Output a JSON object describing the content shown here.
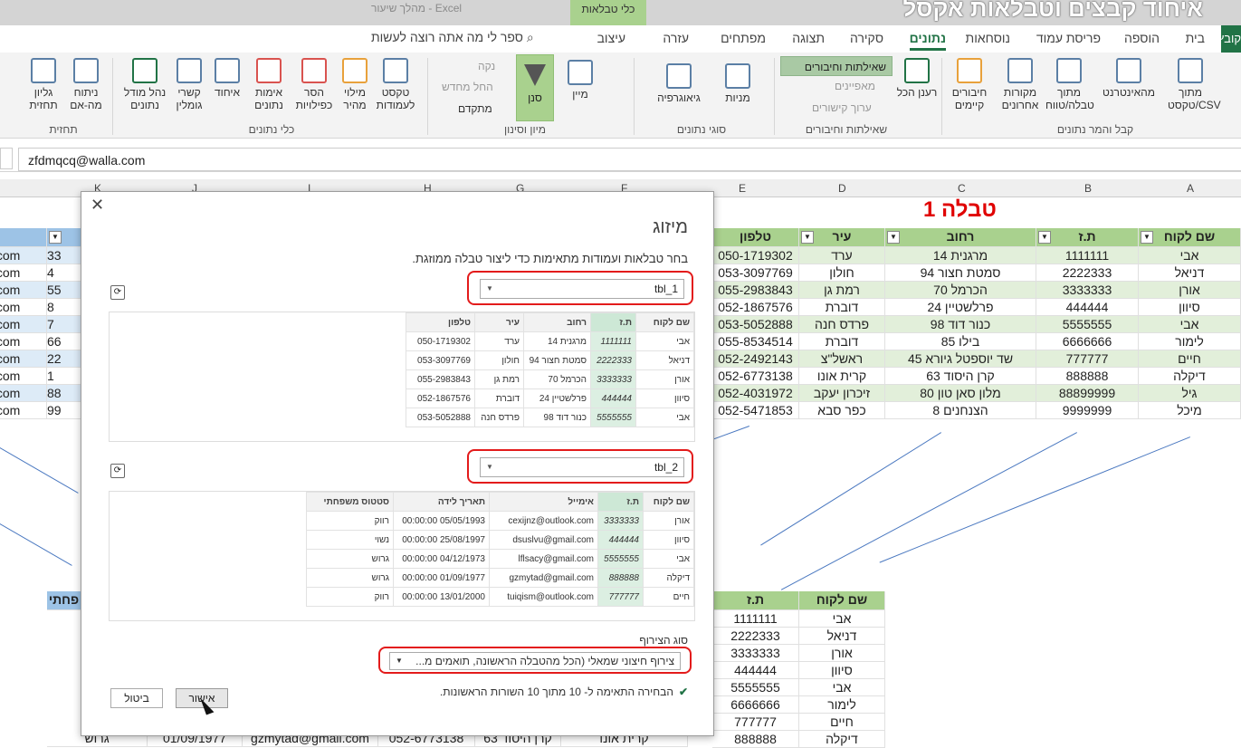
{
  "titlebar": {
    "doc": "מהלך שיעור  -  Excel",
    "context_tab": "כלי טבלאות",
    "overlay_title": "איחוד קבצים וטבלאות אקסל"
  },
  "tabs": {
    "file": "קובץ",
    "home": "בית",
    "insert": "הוספה",
    "layout": "פריסת עמוד",
    "formulas": "נוסחאות",
    "data": "נתונים",
    "review": "סקירה",
    "view": "תצוגה",
    "developer": "מפתחים",
    "help": "עזרה",
    "design": "עיצוב",
    "tellme": "ספר לי מה אתה רוצה לעשות"
  },
  "ribbon": {
    "from_text": "מתוך טקסט/CSV",
    "from_web": "מהאינטרנט",
    "from_table": "מתוך טבלה/טווח",
    "recent": "מקורות אחרונים",
    "existing": "חיבורים קיימים",
    "refresh_all": "רענן הכל",
    "queries_conn": "שאילתות וחיבורים",
    "properties": "מאפיינים",
    "edit_links": "ערוך קישורים",
    "stocks": "מניות",
    "geography": "גיאוגרפיה",
    "sort": "מיין",
    "filter": "סנן",
    "clear": "נקה",
    "reapply": "החל מחדש",
    "advanced": "מתקדם",
    "text_to_cols": "טקסט לעמודות",
    "flash_fill": "מילוי מהיר",
    "remove_dup": "הסר כפילויות",
    "validation": "אימות נתונים",
    "consolidate": "איחוד",
    "relationships": "קשרי גומלין",
    "data_model": "נהל מודל נתונים",
    "whatif": "ניתוח מה-אם",
    "forecast_sheet": "גליון תחזית",
    "grp_get": "קבל והמר נתונים",
    "grp_queries": "שאילתות וחיבורים",
    "grp_types": "סוגי נתונים",
    "grp_sort": "מיון וסינון",
    "grp_tools": "כלי נתונים",
    "grp_forecast": "תחזית"
  },
  "formula_bar": {
    "value": "zfdmqcq@walla.com"
  },
  "columns": [
    "A",
    "B",
    "C",
    "D",
    "E",
    "F",
    "G",
    "H",
    "I",
    "J",
    "K"
  ],
  "table1": {
    "title": "טבלה 1",
    "headers": [
      "שם לקוח",
      "ת.ז",
      "רחוב",
      "עיר",
      "טלפון"
    ],
    "rows": [
      [
        "אבי",
        "1111111",
        "מרגנית 14",
        "ערד",
        "050-1719302"
      ],
      [
        "דניאל",
        "2222333",
        "סמטת חצור 94",
        "חולון",
        "053-3097769"
      ],
      [
        "אורן",
        "3333333",
        "הכרמל 70",
        "רמת גן",
        "055-2983843"
      ],
      [
        "סיוון",
        "444444",
        "פרלשטיין 24",
        "דוברת",
        "052-1867576"
      ],
      [
        "אבי",
        "5555555",
        "כנור דוד 98",
        "פרדס חנה",
        "053-5052888"
      ],
      [
        "לימור",
        "6666666",
        "בילו 85",
        "דוברת",
        "055-8534514"
      ],
      [
        "חיים",
        "777777",
        "שד יוספטל גיורא 45",
        "ראשל\"צ",
        "052-2492143"
      ],
      [
        "דיקלה",
        "888888",
        "קרן היסוד 63",
        "קרית אונו",
        "052-6773138"
      ],
      [
        "גיל",
        "88899999",
        "מלון סאן טון 80",
        "זיכרון יעקב",
        "052-4031972"
      ],
      [
        "מיכל",
        "9999999",
        "הצנחנים 8",
        "כפר סבא",
        "052-5471853"
      ]
    ]
  },
  "table2_left": {
    "col_k": [
      "33",
      "4",
      "55",
      "8",
      "7",
      "66",
      "22",
      "1",
      "88",
      "99"
    ],
    "emails": [
      ".com",
      ".com",
      ".com",
      ".com",
      ".com",
      ".com",
      ".com",
      ".com",
      ".com",
      ".com"
    ],
    "header_partial": "פחתי"
  },
  "table3": {
    "headers": [
      "שם לקוח",
      "ת.ז"
    ],
    "rows": [
      [
        "אבי",
        "1111111"
      ],
      [
        "דניאל",
        "2222333"
      ],
      [
        "אורן",
        "3333333"
      ],
      [
        "סיוון",
        "444444"
      ],
      [
        "אבי",
        "5555555"
      ],
      [
        "לימור",
        "6666666"
      ],
      [
        "חיים",
        "777777"
      ],
      [
        "דיקלה",
        "888888"
      ]
    ]
  },
  "bottom_row": {
    "city": "קרית אונו",
    "street": "קרן היסוד 63",
    "phone": "052-6773138",
    "email": "gzmytad@gmail.com",
    "date": "01/09/1977",
    "status": "גרוש"
  },
  "dialog": {
    "title": "מיזוג",
    "description": "בחר טבלאות ועמודות מתאימות כדי ליצור טבלה ממוזגת.",
    "table1_select": "tbl_1",
    "table2_select": "tbl_2",
    "preview1": {
      "headers": [
        "שם לקוח",
        "ת.ז",
        "רחוב",
        "עיר",
        "טלפון"
      ],
      "rows": [
        [
          "אבי",
          "1111111",
          "מרגנית 14",
          "ערד",
          "050-1719302"
        ],
        [
          "דניאל",
          "2222333",
          "סמטת חצור 94",
          "חולון",
          "053-3097769"
        ],
        [
          "אורן",
          "3333333",
          "הכרמל 70",
          "רמת גן",
          "055-2983843"
        ],
        [
          "סיוון",
          "444444",
          "פרלשטיין 24",
          "דוברת",
          "052-1867576"
        ],
        [
          "אבי",
          "5555555",
          "כנור דוד 98",
          "פרדס חנה",
          "053-5052888"
        ]
      ]
    },
    "preview2": {
      "headers": [
        "שם לקוח",
        "ת.ז",
        "אימייל",
        "תאריך לידה",
        "סטטוס משפחתי"
      ],
      "rows": [
        [
          "אורן",
          "3333333",
          "cexijnz@outlook.com",
          "05/05/1993 00:00:00",
          "רווק"
        ],
        [
          "סיוון",
          "444444",
          "dsuslvu@gmail.com",
          "25/08/1997 00:00:00",
          "נשוי"
        ],
        [
          "אבי",
          "5555555",
          "lflsacy@gmail.com",
          "04/12/1973 00:00:00",
          "גרוש"
        ],
        [
          "דיקלה",
          "888888",
          "gzmytad@gmail.com",
          "01/09/1977 00:00:00",
          "גרוש"
        ],
        [
          "חיים",
          "777777",
          "tuiqism@outlook.com",
          "13/01/2000 00:00:00",
          "רווק"
        ]
      ]
    },
    "join_label": "סוג הצירוף",
    "join_value": "צירוף חיצוני שמאלי (הכל מהטבלה הראשונה, תואמים מ...",
    "match_message": "הבחירה התאימה ל- 10 מתוך 10 השורות הראשונות.",
    "ok": "אישור",
    "cancel": "ביטול"
  },
  "colors": {
    "accent": "#217346",
    "highlight": "#e31b1b",
    "header_green": "#a9d18e"
  }
}
